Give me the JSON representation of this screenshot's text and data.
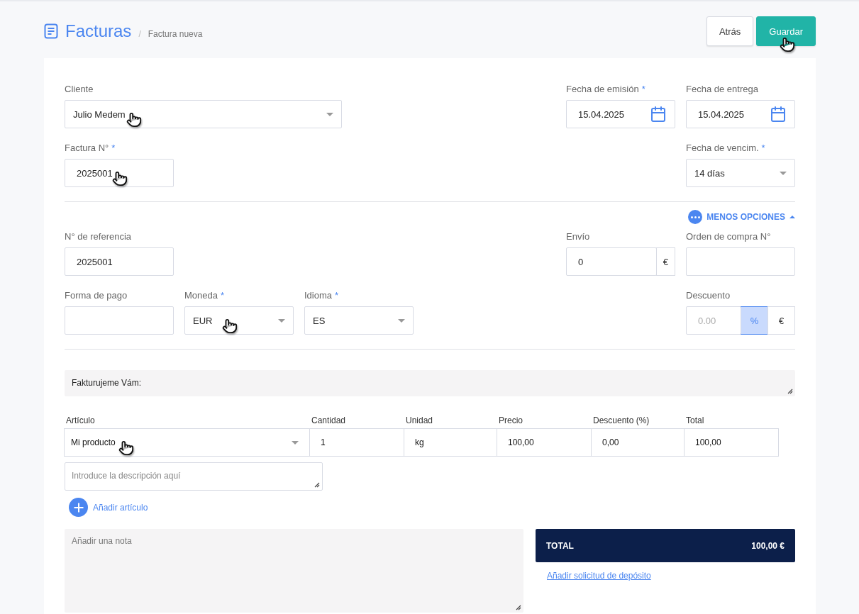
{
  "header": {
    "title": "Facturas",
    "breadcrumb_separator": "/",
    "breadcrumb": "Factura nueva"
  },
  "actions": [
    {
      "label": "Atrás",
      "kind": "secondary"
    },
    {
      "label": "Guardar",
      "kind": "primary",
      "cursor": true
    }
  ],
  "client": {
    "label": "Cliente",
    "value": "Julio Medem",
    "cursor": true
  },
  "issue_date": {
    "label": "Fecha de emisión",
    "required_mark": "*",
    "value": "15.04.2025"
  },
  "delivery_date": {
    "label": "Fecha de entrega",
    "value": "15.04.2025"
  },
  "invoice_number": {
    "label": "Factura N°",
    "required_mark": "*",
    "value": "2025001",
    "cursor": true
  },
  "due_date": {
    "label": "Fecha de vencim.",
    "required_mark": "*",
    "value": "14 días"
  },
  "options_toggle": {
    "label": "MENOS OPCIONES",
    "expanded": true
  },
  "reference": {
    "label": "N° de referencia",
    "value": "2025001"
  },
  "shipping": {
    "label": "Envío",
    "value": "0",
    "suffix": "€"
  },
  "purchase_order": {
    "label": "Orden de compra N°"
  },
  "payment_method": {
    "label": "Forma de pago"
  },
  "currency": {
    "label": "Moneda",
    "required_mark": "*",
    "value": "EUR",
    "cursor": true
  },
  "language": {
    "label": "Idioma",
    "required_mark": "*",
    "value": "ES"
  },
  "discount": {
    "label": "Descuento",
    "placeholder": "0.00",
    "units": [
      {
        "label": "%",
        "selected": true
      },
      {
        "label": "€",
        "selected": false
      }
    ]
  },
  "header_text": "Fakturujeme Vám:",
  "items": {
    "columns": [
      "Artículo",
      "Cantidad",
      "Unidad",
      "Precio",
      "Descuento (%)",
      "Total"
    ],
    "rows": [
      {
        "cells": [
          "Mi producto",
          "1",
          "kg",
          "100,00",
          "0,00",
          "100,00"
        ],
        "cursor": true,
        "description_placeholder": "Introduce la descripción aquí"
      }
    ],
    "add_label": "Añadir artículo"
  },
  "note": {
    "placeholder": "Añadir una nota"
  },
  "total": {
    "label": "TOTAL",
    "value": "100,00 €"
  },
  "deposit_link": "Añadir solicitud de depósito"
}
